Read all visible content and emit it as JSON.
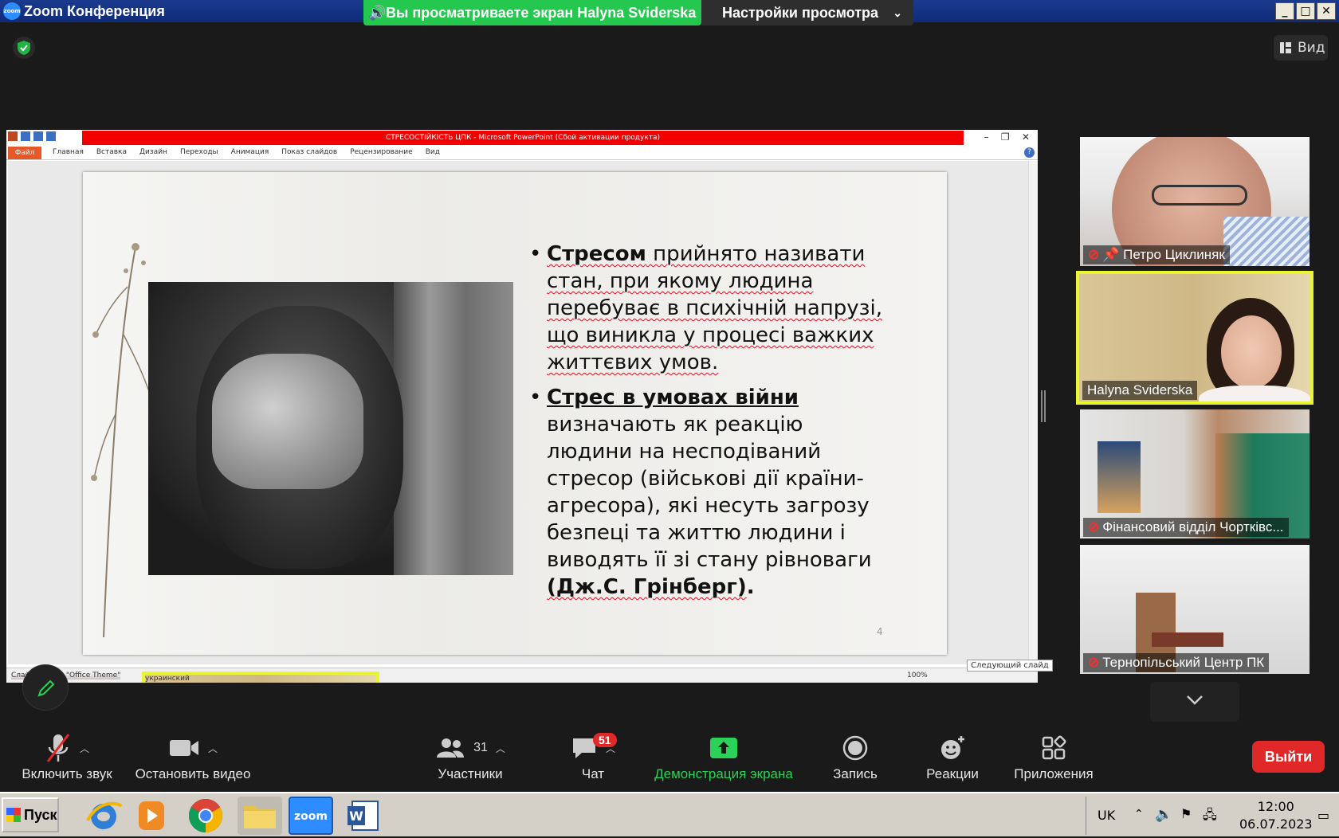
{
  "window": {
    "title": "Zoom Конференция",
    "share_banner": "Вы просматриваете экран Halyna Sviderska",
    "view_settings": "Настройки просмотра",
    "view_button": "Вид",
    "controls": [
      "minimize",
      "maximize",
      "close"
    ]
  },
  "powerpoint": {
    "title": "СТРЕСОСТІЙКІСТЬ ЦПК  -  Microsoft PowerPoint (Сбой активации продукта)",
    "file_tab": "Файл",
    "tabs": [
      "Главная",
      "Вставка",
      "Дизайн",
      "Переходы",
      "Анимация",
      "Показ слайдов",
      "Рецензирование",
      "Вид"
    ],
    "status_slide": "Слайд 4 из 14  \"Office Theme\"",
    "status_lang": "украинский",
    "zoom": "100%",
    "next_slide_tip": "Следующий слайд"
  },
  "slide": {
    "number": "4",
    "bullet1": {
      "bold": "Стресом",
      "text": " прийнято називати стан, при якому людина перебуває в психічній напрузі, що виникла у процесі важких життєвих умов."
    },
    "bullet2": {
      "bold": "Стрес в умовах війни",
      "text": "визначають як реакцію людини на несподіваний стресор (військові дії країни-агресора), які несуть загрозу безпеці та життю людини і виводять її зі стану рівноваги",
      "citation": "(Дж.С. Грінберг)",
      "end": "."
    }
  },
  "participants": [
    {
      "name": "Петро Циклиняк",
      "muted": true,
      "pinned": true
    },
    {
      "name": "Halyna Sviderska",
      "muted": false,
      "active_speaker": true
    },
    {
      "name": "Фінансовий відділ Чортківс...",
      "muted": true
    },
    {
      "name": "Тернопільський Центр ПК",
      "muted": true
    }
  ],
  "toolbar": {
    "audio": "Включить звук",
    "video": "Остановить видео",
    "participants": "Участники",
    "participants_count": "31",
    "chat": "Чат",
    "chat_badge": "51",
    "share": "Демонстрация экрана",
    "record": "Запись",
    "reactions": "Реакции",
    "apps": "Приложения",
    "leave": "Выйти"
  },
  "taskbar": {
    "start": "Пуск",
    "apps": [
      "internet-explorer",
      "media-player",
      "chrome",
      "file-explorer",
      "zoom",
      "word"
    ],
    "zoom_label": "zoom",
    "lang": "UK",
    "time": "12:00",
    "date": "06.07.2023"
  },
  "colors": {
    "share_green": "#24c84f",
    "active_border": "#e7f532",
    "leave_red": "#e02828",
    "ppt_red": "#f20000"
  }
}
